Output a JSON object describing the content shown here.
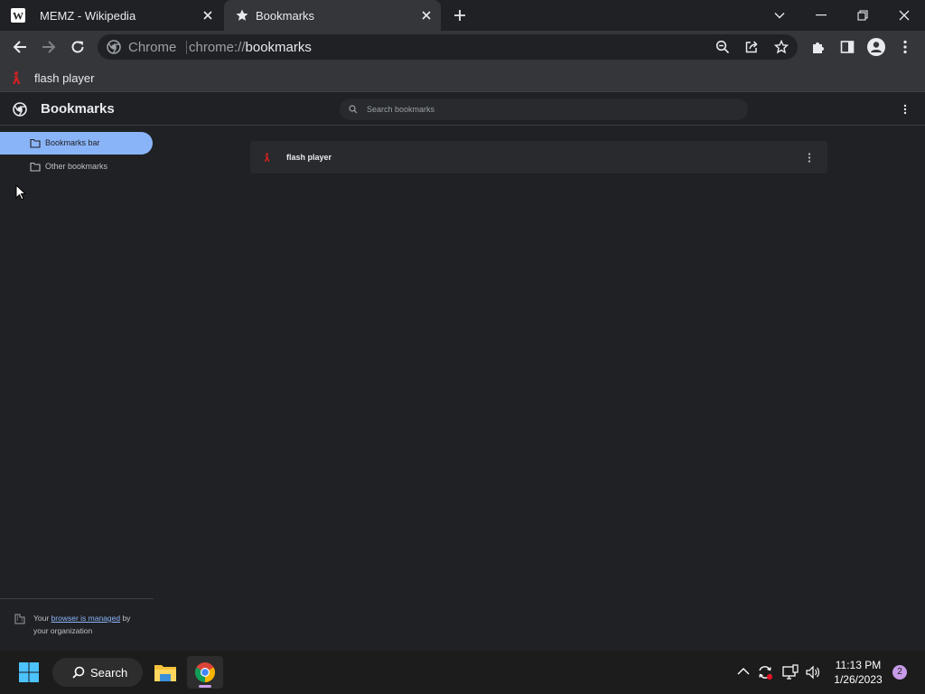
{
  "tabs": [
    {
      "title": "MEMZ - Wikipedia",
      "favicon": "wikipedia-icon",
      "active": false
    },
    {
      "title": "Bookmarks",
      "favicon": "star-icon",
      "active": true
    }
  ],
  "toolbar": {
    "site_label": "Chrome",
    "url_scheme": "chrome://",
    "url_host": "bookmarks"
  },
  "bookmarks_bar": {
    "items": [
      {
        "label": "flash player",
        "icon": "flash-player-icon"
      }
    ]
  },
  "page": {
    "title": "Bookmarks",
    "search_placeholder": "Search bookmarks"
  },
  "sidebar": {
    "folders": [
      {
        "label": "Bookmarks bar",
        "selected": true
      },
      {
        "label": "Other bookmarks",
        "selected": false
      }
    ],
    "managed_notice": {
      "prefix": "Your ",
      "link": "browser is managed",
      "suffix": " by your organization"
    }
  },
  "bookmark_list": [
    {
      "label": "flash player",
      "icon": "flash-player-icon"
    }
  ],
  "taskbar": {
    "search_label": "Search",
    "time": "11:13 PM",
    "date": "1/26/2023",
    "notification_count": "2"
  },
  "colors": {
    "accent": "#8ab4f8",
    "background": "#202124",
    "toolbar": "#35363a",
    "flash_red": "#cc2222"
  }
}
